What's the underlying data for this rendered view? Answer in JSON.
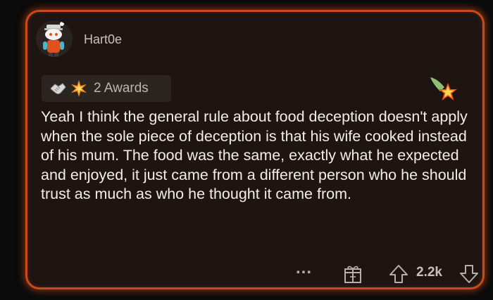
{
  "comment": {
    "username": "Hart0e",
    "awards_label": "2 Awards",
    "body": "Yeah I think the general rule about food deception doesn't apply when the sole piece of deception is that his wife cooked instead of his mum. The food was the same, exactly what he expected and enjoyed, it just came from a different person who he should trust as much as who he thought it came from.",
    "score": "2.2k",
    "more_label": "..."
  },
  "colors": {
    "background": "#0b0b0b",
    "card": "#1e1513",
    "border_glow": "#c94a1a",
    "text": "#f2ede9",
    "muted": "#bdb5af"
  },
  "icons": {
    "avatar": "snoo-avatar-icon",
    "award_1": "handshake-award-icon",
    "award_2": "starburst-award-icon",
    "top_badge": "star-comet-badge-icon",
    "gift": "gift-icon",
    "upvote": "upvote-arrow-icon",
    "downvote": "downvote-arrow-icon"
  }
}
